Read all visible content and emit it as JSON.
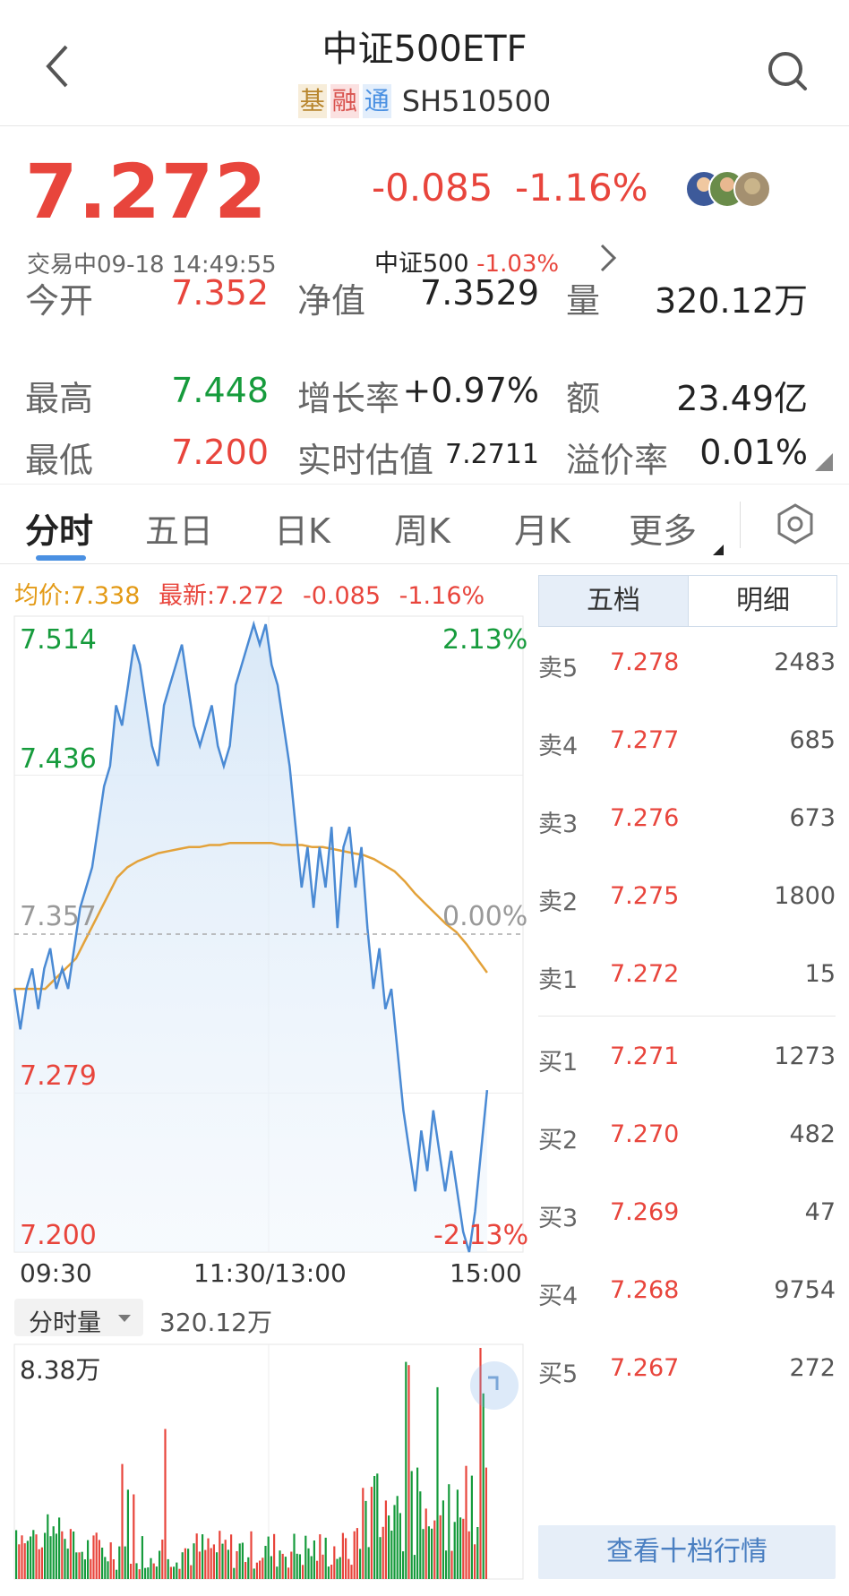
{
  "header": {
    "title": "中证500ETF",
    "tags": [
      "基",
      "融",
      "通"
    ],
    "code": "SH510500"
  },
  "quote": {
    "price": "7.272",
    "change": "-0.085",
    "change_pct": "-1.16%",
    "status": "交易中09-18 14:49:55",
    "index_name": "中证500",
    "index_change": "-1.03%"
  },
  "stats": [
    {
      "label": "今开",
      "value": "7.352",
      "color": "#e8453c"
    },
    {
      "label": "净值",
      "value": "7.3529",
      "color": "#222222"
    },
    {
      "label": "量",
      "value": "320.12万",
      "color": "#222222"
    },
    {
      "label": "最高",
      "value": "7.448",
      "color": "#169b3c"
    },
    {
      "label": "增长率",
      "value": "+0.97%",
      "color": "#222222"
    },
    {
      "label": "额",
      "value": "23.49亿",
      "color": "#222222"
    },
    {
      "label": "最低",
      "value": "7.200",
      "color": "#e8453c"
    },
    {
      "label": "实时估值",
      "value": "7.2711",
      "color": "#222222"
    },
    {
      "label": "溢价率",
      "value": "0.01%",
      "color": "#222222"
    }
  ],
  "tabs": [
    "分时",
    "五日",
    "日K",
    "周K",
    "月K",
    "更多"
  ],
  "chart_info": {
    "avg": "均价:7.338",
    "latest": "最新:7.272",
    "change": "-0.085",
    "pct": "-1.16%"
  },
  "chart_data": {
    "type": "line",
    "series": [
      {
        "name": "最新",
        "color": "#4a8ad4",
        "values": [
          7.33,
          7.31,
          7.33,
          7.34,
          7.32,
          7.34,
          7.35,
          7.33,
          7.34,
          7.33,
          7.35,
          7.37,
          7.38,
          7.39,
          7.41,
          7.43,
          7.44,
          7.47,
          7.46,
          7.48,
          7.5,
          7.49,
          7.47,
          7.45,
          7.44,
          7.47,
          7.48,
          7.49,
          7.5,
          7.48,
          7.46,
          7.45,
          7.46,
          7.47,
          7.45,
          7.44,
          7.45,
          7.48,
          7.49,
          7.5,
          7.51,
          7.5,
          7.51,
          7.49,
          7.48,
          7.46,
          7.44,
          7.41,
          7.38,
          7.4,
          7.37,
          7.4,
          7.38,
          7.41,
          7.36,
          7.4,
          7.41,
          7.38,
          7.4,
          7.36,
          7.33,
          7.35,
          7.32,
          7.33,
          7.3,
          7.27,
          7.25,
          7.23,
          7.26,
          7.24,
          7.27,
          7.25,
          7.23,
          7.25,
          7.23,
          7.21,
          7.2,
          7.22,
          7.25,
          7.28
        ]
      },
      {
        "name": "均价",
        "color": "#e3a23a",
        "values": [
          7.33,
          7.33,
          7.33,
          7.33,
          7.335,
          7.34,
          7.345,
          7.355,
          7.365,
          7.375,
          7.385,
          7.39,
          7.393,
          7.395,
          7.397,
          7.398,
          7.399,
          7.4,
          7.4,
          7.401,
          7.401,
          7.402,
          7.402,
          7.402,
          7.402,
          7.402,
          7.401,
          7.401,
          7.401,
          7.4,
          7.4,
          7.399,
          7.398,
          7.397,
          7.396,
          7.394,
          7.391,
          7.388,
          7.383,
          7.377,
          7.372,
          7.367,
          7.362,
          7.358,
          7.352,
          7.345,
          7.338
        ]
      }
    ],
    "y_ticks_left": [
      "7.514",
      "7.436",
      "7.357",
      "7.279",
      "7.200"
    ],
    "y_ticks_right": [
      "2.13%",
      "0.00%",
      "-2.13%"
    ],
    "x_ticks": [
      "09:30",
      "11:30/13:00",
      "15:00"
    ],
    "ylim": [
      7.2,
      7.514
    ],
    "prev_close": 7.357
  },
  "volume": {
    "selector": "分时量",
    "total": "320.12万",
    "max_label": "8.38万"
  },
  "orderbook": {
    "tabs": [
      "五档",
      "明细"
    ],
    "asks": [
      {
        "label": "卖5",
        "price": "7.278",
        "vol": "2483"
      },
      {
        "label": "卖4",
        "price": "7.277",
        "vol": "685"
      },
      {
        "label": "卖3",
        "price": "7.276",
        "vol": "673"
      },
      {
        "label": "卖2",
        "price": "7.275",
        "vol": "1800"
      },
      {
        "label": "卖1",
        "price": "7.272",
        "vol": "15"
      }
    ],
    "bids": [
      {
        "label": "买1",
        "price": "7.271",
        "vol": "1273"
      },
      {
        "label": "买2",
        "price": "7.270",
        "vol": "482"
      },
      {
        "label": "买3",
        "price": "7.269",
        "vol": "47"
      },
      {
        "label": "买4",
        "price": "7.268",
        "vol": "9754"
      },
      {
        "label": "买5",
        "price": "7.267",
        "vol": "272"
      }
    ],
    "more_button": "查看十档行情"
  }
}
